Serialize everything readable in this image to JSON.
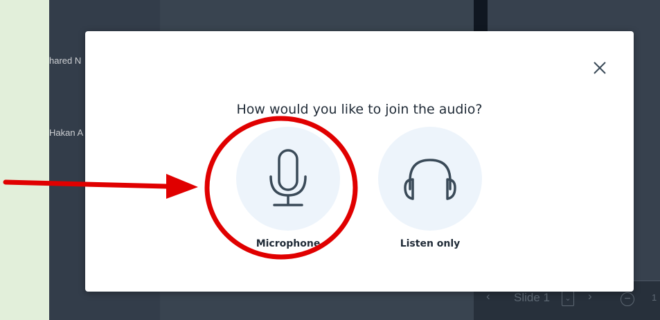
{
  "sidebar": {
    "users": [
      {
        "name": "hared N"
      },
      {
        "name": "Hakan A"
      }
    ]
  },
  "slide_controls": {
    "prev_icon": "chevron-left-icon",
    "slide_label": "Slide 1",
    "dropdown_icon": "chevron-down-icon",
    "next_icon": "chevron-right-icon",
    "zoom_out_icon": "minus-circle-icon",
    "trailing_text": "1"
  },
  "modal": {
    "title": "How would you like to join the audio?",
    "close_icon": "close-icon",
    "options": [
      {
        "label": "Microphone",
        "icon": "microphone-icon"
      },
      {
        "label": "Listen only",
        "icon": "headphones-icon"
      }
    ]
  },
  "annotation": {
    "color": "#e00000",
    "arrow": "pointing right",
    "highlight": "circle around Microphone"
  },
  "colors": {
    "icon_stroke": "#3a4a58",
    "option_bg": "#edf4fb",
    "page_bg": "#e2efda"
  }
}
